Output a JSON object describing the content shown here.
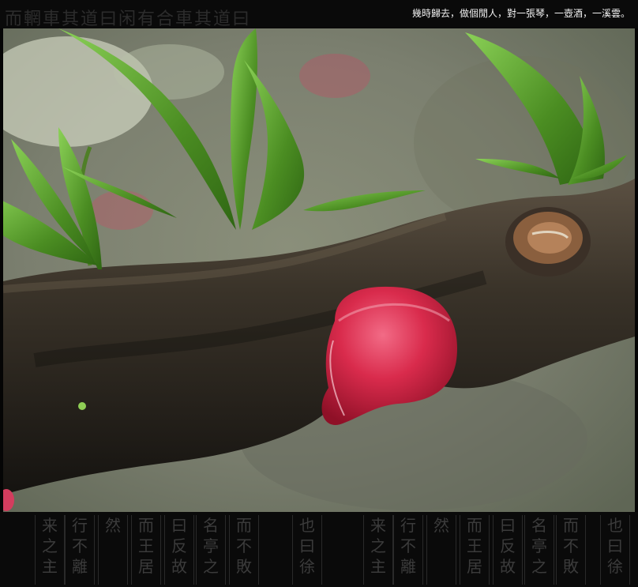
{
  "caption": "幾時歸去，做個閒人，對一張琴，一壺酒，一溪雲。",
  "top_calligraphy": "而輞車其道曰闲有合車其道曰",
  "bottom_calligraphy_columns": [
    "来之主",
    "行不離",
    "然",
    "而王居",
    "曰反故",
    "名亭之",
    "而不敗",
    "也曰徐",
    "来之主",
    "行不離",
    "然",
    "而王居",
    "曰反故",
    "名亭之",
    "而不敗",
    "也曰徐"
  ],
  "photo": {
    "subject": "peach blossom bud on branch",
    "colors": {
      "bud": "#d8284b",
      "bud_highlight": "#f05777",
      "branch": "#2f2a22",
      "leaf": "#4f8d24",
      "leaf_light": "#7cc447",
      "background": "#8a9378"
    }
  }
}
